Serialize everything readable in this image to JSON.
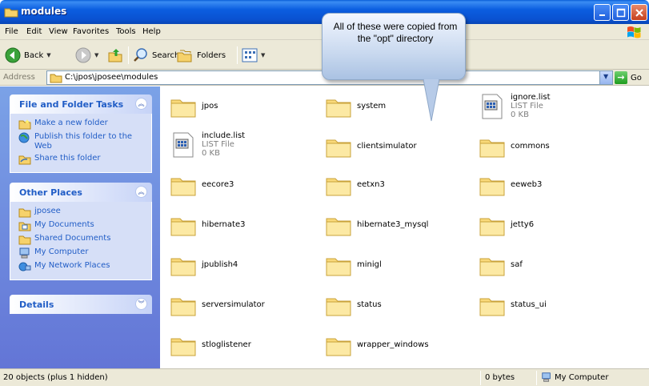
{
  "window": {
    "title": "modules"
  },
  "menu": [
    "File",
    "Edit",
    "View",
    "Favorites",
    "Tools",
    "Help"
  ],
  "toolbar": {
    "back": "Back",
    "search": "Search",
    "folders": "Folders"
  },
  "address": {
    "label": "Address",
    "path": "C:\\jpos\\jposee\\modules",
    "go": "Go"
  },
  "tasks": {
    "file_folder": {
      "title": "File and Folder Tasks",
      "items": [
        "Make a new folder",
        "Publish this folder to the Web",
        "Share this folder"
      ]
    },
    "other_places": {
      "title": "Other Places",
      "items": [
        "jposee",
        "My Documents",
        "Shared Documents",
        "My Computer",
        "My Network Places"
      ]
    },
    "details": {
      "title": "Details"
    }
  },
  "files": [
    {
      "name": "jpos",
      "type": "folder"
    },
    {
      "name": "system",
      "type": "folder"
    },
    {
      "name": "ignore.list",
      "type": "file",
      "kind": "LIST File",
      "size": "0 KB"
    },
    {
      "name": "include.list",
      "type": "file",
      "kind": "LIST File",
      "size": "0 KB"
    },
    {
      "name": "clientsimulator",
      "type": "folder"
    },
    {
      "name": "commons",
      "type": "folder"
    },
    {
      "name": "eecore3",
      "type": "folder"
    },
    {
      "name": "eetxn3",
      "type": "folder"
    },
    {
      "name": "eeweb3",
      "type": "folder"
    },
    {
      "name": "hibernate3",
      "type": "folder"
    },
    {
      "name": "hibernate3_mysql",
      "type": "folder"
    },
    {
      "name": "jetty6",
      "type": "folder"
    },
    {
      "name": "jpublish4",
      "type": "folder"
    },
    {
      "name": "minigl",
      "type": "folder"
    },
    {
      "name": "saf",
      "type": "folder"
    },
    {
      "name": "serversimulator",
      "type": "folder"
    },
    {
      "name": "status",
      "type": "folder"
    },
    {
      "name": "status_ui",
      "type": "folder"
    },
    {
      "name": "stloglistener",
      "type": "folder"
    },
    {
      "name": "wrapper_windows",
      "type": "folder"
    }
  ],
  "status": {
    "objects": "20 objects (plus 1 hidden)",
    "size": "0 bytes",
    "location": "My Computer"
  },
  "callout": {
    "text": "All of these were copied from the \"opt\" directory"
  },
  "colors": {
    "titlebar": "#0a52d1",
    "taskpane": "#6f8ee0",
    "link": "#215dc6"
  }
}
